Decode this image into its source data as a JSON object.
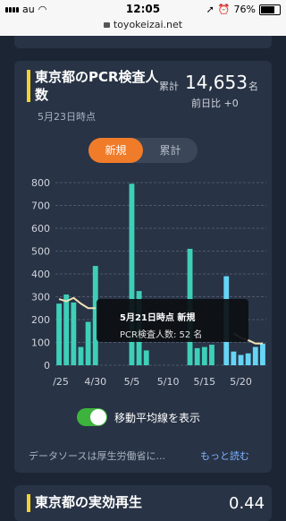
{
  "statusbar": {
    "carrier": "au",
    "time": "12:05",
    "battery": "76%",
    "url": "toyokeizai.net"
  },
  "card": {
    "title": "東京都のPCR検査人数",
    "total_label": "累計",
    "total_value": "14,653",
    "total_unit": "名",
    "diff": "前日比 +0",
    "asof": "5月23日時点",
    "tabs": [
      {
        "label": "新規",
        "active": true
      },
      {
        "label": "累計",
        "active": false
      }
    ],
    "tooltip_title": "5月21日時点 新規",
    "tooltip_body": "PCR検査人数: 52 名",
    "moving_avg_label": "移動平均線を表示",
    "moving_avg_on": true,
    "source_text": "データソースは厚生労働省に...",
    "more_link": "もっと読む"
  },
  "next_card": {
    "title": "東京都の実効再生",
    "value": "0.44"
  },
  "chart_data": {
    "type": "bar",
    "ylim": [
      0,
      800
    ],
    "y_ticks": [
      0,
      100,
      200,
      300,
      400,
      500,
      600,
      700,
      800
    ],
    "x_tick_labels": [
      "/25",
      "4/30",
      "5/5",
      "5/10",
      "5/15",
      "5/20"
    ],
    "categories": [
      "4/25",
      "4/26",
      "4/27",
      "4/28",
      "4/29",
      "4/30",
      "5/1",
      "5/2",
      "5/3",
      "5/4",
      "5/5",
      "5/6",
      "5/7",
      "5/8",
      "5/9",
      "5/10",
      "5/11",
      "5/12",
      "5/13",
      "5/14",
      "5/15",
      "5/16",
      "5/17",
      "5/18",
      "5/19",
      "5/20",
      "5/21",
      "5/22",
      "5/23"
    ],
    "values": [
      270,
      310,
      275,
      80,
      190,
      435,
      0,
      0,
      0,
      0,
      795,
      325,
      65,
      0,
      0,
      0,
      0,
      0,
      510,
      75,
      80,
      90,
      0,
      390,
      60,
      45,
      52,
      80,
      95
    ],
    "moving_average": [
      290,
      280,
      295,
      270,
      250,
      250,
      null,
      null,
      null,
      null,
      null,
      null,
      null,
      null,
      null,
      null,
      null,
      null,
      null,
      null,
      null,
      null,
      null,
      null,
      140,
      120,
      110,
      95,
      95
    ],
    "colors": {
      "bar": "#3ecfb8",
      "bar_highlight": "#66d4f5",
      "moving_average": "#efe2b6",
      "grid": "#5a6578",
      "tick": "#d0d4dc"
    }
  }
}
